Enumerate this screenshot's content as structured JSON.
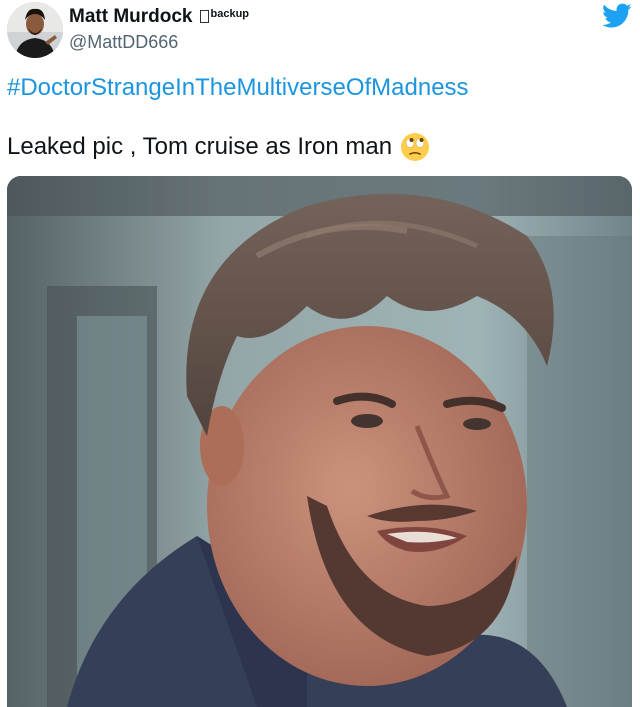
{
  "user": {
    "display_name": "Matt Murdock",
    "name_suffix": "backup",
    "handle": "@MattDD666"
  },
  "tweet": {
    "hashtag": "#DoctorStrangeInTheMultiverseOfMadness",
    "text": "Leaked pic , Tom cruise as Iron man",
    "emoji": "face-with-rolling-eyes"
  },
  "icons": {
    "brand": "twitter-bird-icon"
  },
  "colors": {
    "hashtag": "#1b95e0",
    "twitter_blue": "#1da1f2",
    "handle": "#536471"
  }
}
